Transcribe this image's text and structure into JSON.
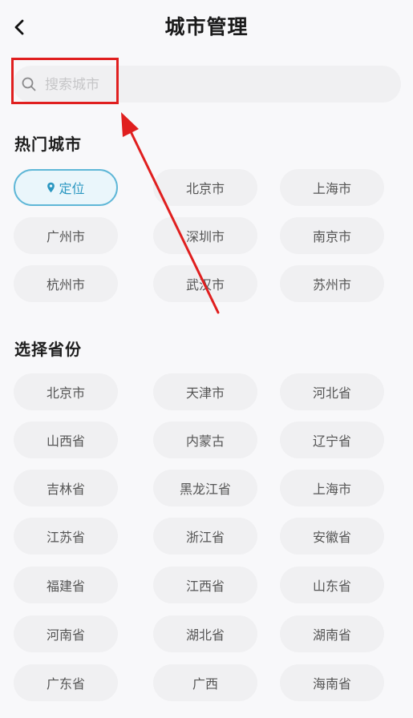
{
  "header": {
    "title": "城市管理"
  },
  "search": {
    "placeholder": "搜索城市",
    "value": ""
  },
  "hot": {
    "title": "热门城市",
    "locate_label": "定位",
    "cities": [
      "北京市",
      "上海市",
      "广州市",
      "深圳市",
      "南京市",
      "杭州市",
      "武汉市",
      "苏州市"
    ]
  },
  "provinces": {
    "title": "选择省份",
    "items": [
      "北京市",
      "天津市",
      "河北省",
      "山西省",
      "内蒙古",
      "辽宁省",
      "吉林省",
      "黑龙江省",
      "上海市",
      "江苏省",
      "浙江省",
      "安徽省",
      "福建省",
      "江西省",
      "山东省",
      "河南省",
      "湖北省",
      "湖南省",
      "广东省",
      "广西",
      "海南省"
    ]
  },
  "colors": {
    "accent": "#2b97c1",
    "annotation": "#e01f1f",
    "chip_bg": "#f0f0f2",
    "page_bg": "#f8f8fa"
  },
  "icons": {
    "back": "chevron-left-icon",
    "search": "search-icon",
    "locate": "location-pin-icon"
  }
}
